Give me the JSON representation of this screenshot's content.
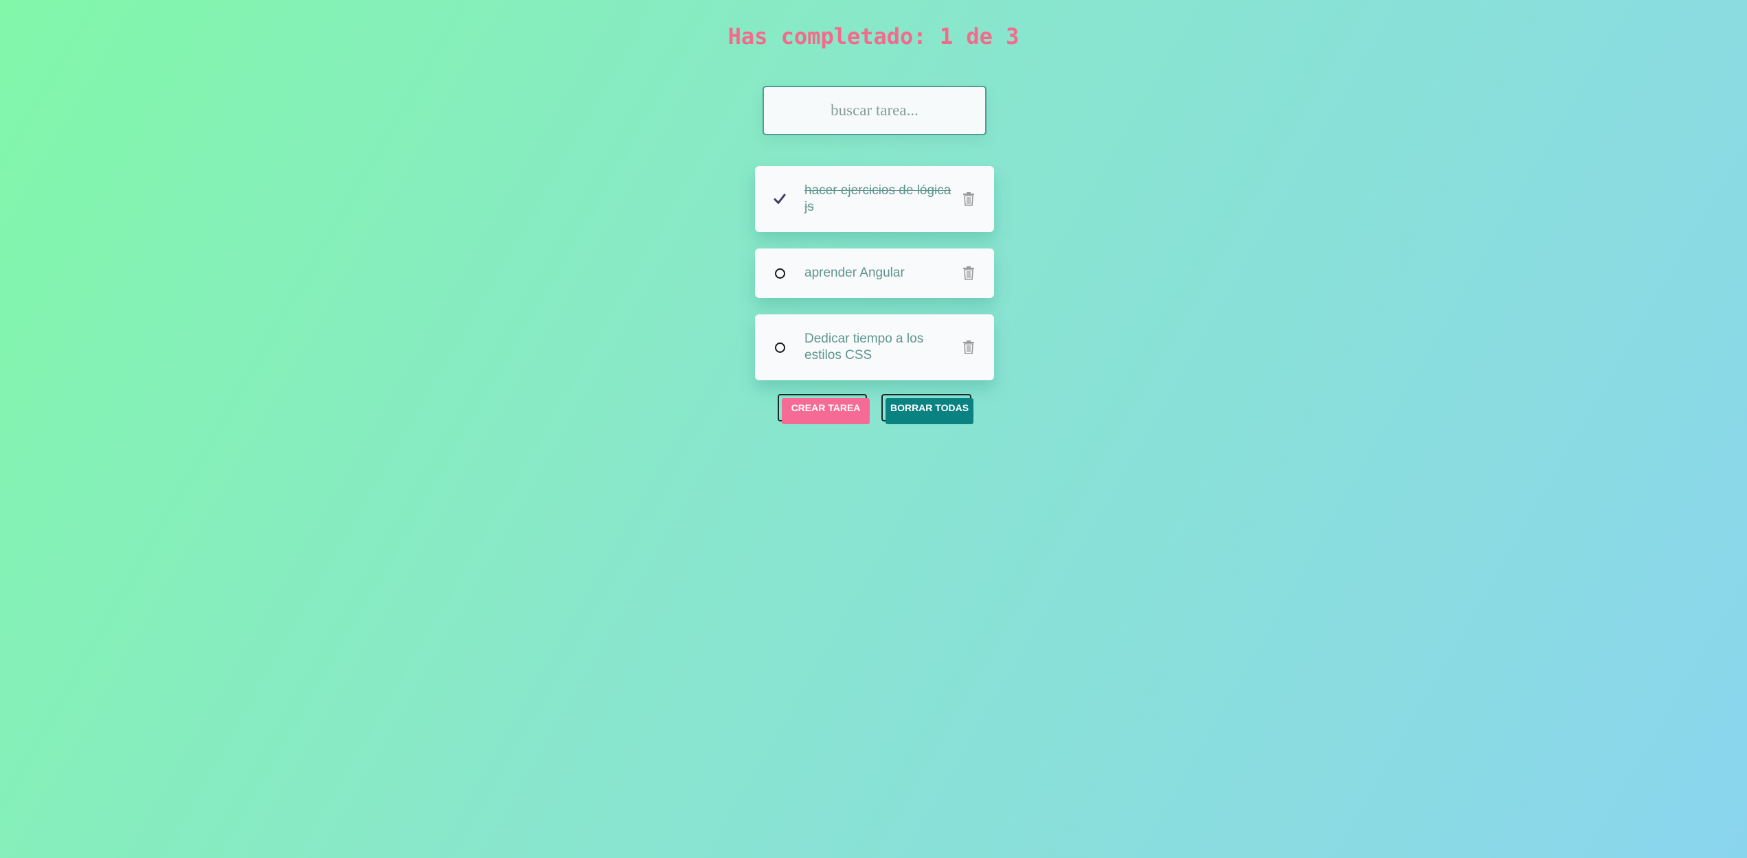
{
  "header": {
    "counter_text": "Has completado: 1 de 3"
  },
  "search": {
    "placeholder": "buscar tarea...",
    "value": ""
  },
  "todos": [
    {
      "text": "hacer ejercicios de lógica js",
      "completed": true
    },
    {
      "text": "aprender Angular",
      "completed": false
    },
    {
      "text": "Dedicar tiempo a los estilos CSS",
      "completed": false
    }
  ],
  "actions": {
    "create_label": "CREAR TAREA",
    "clear_label": "BORRAR TODAS"
  },
  "colors": {
    "accent_pink": "#f66b96",
    "accent_teal": "#0b8282",
    "todo_text": "#5f958d",
    "counter": "#f36a8c"
  },
  "icons": {
    "check": "check-icon",
    "pending": "circle-icon",
    "delete": "trash-icon"
  }
}
